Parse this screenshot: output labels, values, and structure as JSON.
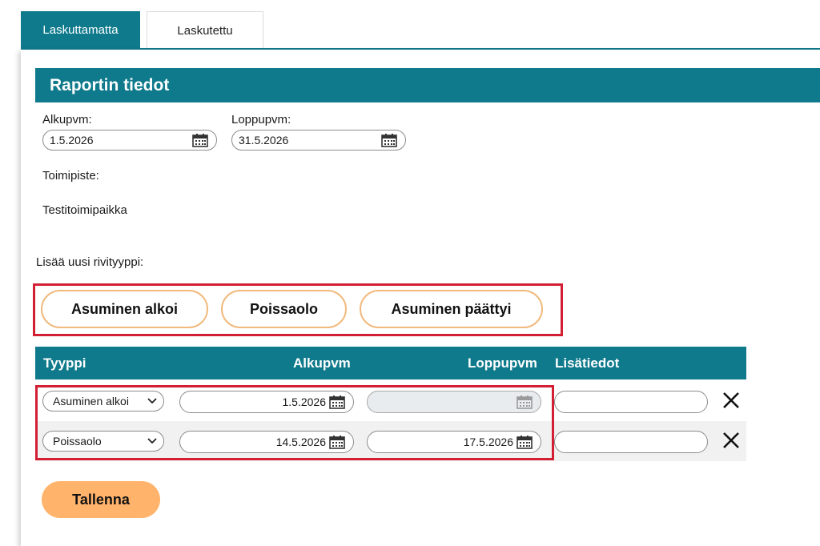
{
  "tabs": [
    {
      "label": "Laskuttamatta",
      "active": true
    },
    {
      "label": "Laskutettu",
      "active": false
    }
  ],
  "section": {
    "title": "Raportin tiedot"
  },
  "report": {
    "start_label": "Alkupvm:",
    "start_value": "1.5.2026",
    "end_label": "Loppupvm:",
    "end_value": "31.5.2026",
    "office_label": "Toimipiste:",
    "office_value": "Testitoimipaikka"
  },
  "add_row": {
    "label": "Lisää uusi rivityyppi:",
    "buttons": [
      "Asuminen alkoi",
      "Poissaolo",
      "Asuminen päättyi"
    ]
  },
  "table": {
    "headers": {
      "type": "Tyyppi",
      "start": "Alkupvm",
      "end": "Loppupvm",
      "extra": "Lisätiedot"
    },
    "rows": [
      {
        "type": "Asuminen alkoi",
        "start": "1.5.2026",
        "end": "",
        "end_disabled": true,
        "extra": ""
      },
      {
        "type": "Poissaolo",
        "start": "14.5.2026",
        "end": "17.5.2026",
        "end_disabled": false,
        "extra": ""
      }
    ]
  },
  "actions": {
    "save_label": "Tallenna"
  },
  "colors": {
    "accent": "#0f7a8c",
    "button_orange": "#ffb36b",
    "highlight_red": "#d21f34"
  },
  "icons": {
    "calendar": "calendar-icon",
    "chevron": "chevron-down-icon",
    "delete": "close-icon"
  }
}
